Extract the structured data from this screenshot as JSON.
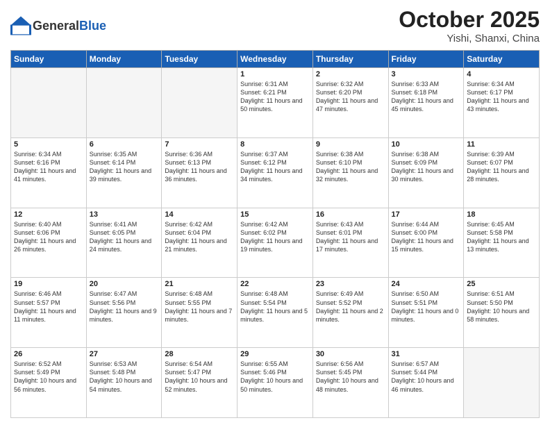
{
  "header": {
    "logo_general": "General",
    "logo_blue": "Blue",
    "month": "October 2025",
    "location": "Yishi, Shanxi, China"
  },
  "weekdays": [
    "Sunday",
    "Monday",
    "Tuesday",
    "Wednesday",
    "Thursday",
    "Friday",
    "Saturday"
  ],
  "weeks": [
    [
      {
        "day": "",
        "info": ""
      },
      {
        "day": "",
        "info": ""
      },
      {
        "day": "",
        "info": ""
      },
      {
        "day": "1",
        "info": "Sunrise: 6:31 AM\nSunset: 6:21 PM\nDaylight: 11 hours\nand 50 minutes."
      },
      {
        "day": "2",
        "info": "Sunrise: 6:32 AM\nSunset: 6:20 PM\nDaylight: 11 hours\nand 47 minutes."
      },
      {
        "day": "3",
        "info": "Sunrise: 6:33 AM\nSunset: 6:18 PM\nDaylight: 11 hours\nand 45 minutes."
      },
      {
        "day": "4",
        "info": "Sunrise: 6:34 AM\nSunset: 6:17 PM\nDaylight: 11 hours\nand 43 minutes."
      }
    ],
    [
      {
        "day": "5",
        "info": "Sunrise: 6:34 AM\nSunset: 6:16 PM\nDaylight: 11 hours\nand 41 minutes."
      },
      {
        "day": "6",
        "info": "Sunrise: 6:35 AM\nSunset: 6:14 PM\nDaylight: 11 hours\nand 39 minutes."
      },
      {
        "day": "7",
        "info": "Sunrise: 6:36 AM\nSunset: 6:13 PM\nDaylight: 11 hours\nand 36 minutes."
      },
      {
        "day": "8",
        "info": "Sunrise: 6:37 AM\nSunset: 6:12 PM\nDaylight: 11 hours\nand 34 minutes."
      },
      {
        "day": "9",
        "info": "Sunrise: 6:38 AM\nSunset: 6:10 PM\nDaylight: 11 hours\nand 32 minutes."
      },
      {
        "day": "10",
        "info": "Sunrise: 6:38 AM\nSunset: 6:09 PM\nDaylight: 11 hours\nand 30 minutes."
      },
      {
        "day": "11",
        "info": "Sunrise: 6:39 AM\nSunset: 6:07 PM\nDaylight: 11 hours\nand 28 minutes."
      }
    ],
    [
      {
        "day": "12",
        "info": "Sunrise: 6:40 AM\nSunset: 6:06 PM\nDaylight: 11 hours\nand 26 minutes."
      },
      {
        "day": "13",
        "info": "Sunrise: 6:41 AM\nSunset: 6:05 PM\nDaylight: 11 hours\nand 24 minutes."
      },
      {
        "day": "14",
        "info": "Sunrise: 6:42 AM\nSunset: 6:04 PM\nDaylight: 11 hours\nand 21 minutes."
      },
      {
        "day": "15",
        "info": "Sunrise: 6:42 AM\nSunset: 6:02 PM\nDaylight: 11 hours\nand 19 minutes."
      },
      {
        "day": "16",
        "info": "Sunrise: 6:43 AM\nSunset: 6:01 PM\nDaylight: 11 hours\nand 17 minutes."
      },
      {
        "day": "17",
        "info": "Sunrise: 6:44 AM\nSunset: 6:00 PM\nDaylight: 11 hours\nand 15 minutes."
      },
      {
        "day": "18",
        "info": "Sunrise: 6:45 AM\nSunset: 5:58 PM\nDaylight: 11 hours\nand 13 minutes."
      }
    ],
    [
      {
        "day": "19",
        "info": "Sunrise: 6:46 AM\nSunset: 5:57 PM\nDaylight: 11 hours\nand 11 minutes."
      },
      {
        "day": "20",
        "info": "Sunrise: 6:47 AM\nSunset: 5:56 PM\nDaylight: 11 hours\nand 9 minutes."
      },
      {
        "day": "21",
        "info": "Sunrise: 6:48 AM\nSunset: 5:55 PM\nDaylight: 11 hours\nand 7 minutes."
      },
      {
        "day": "22",
        "info": "Sunrise: 6:48 AM\nSunset: 5:54 PM\nDaylight: 11 hours\nand 5 minutes."
      },
      {
        "day": "23",
        "info": "Sunrise: 6:49 AM\nSunset: 5:52 PM\nDaylight: 11 hours\nand 2 minutes."
      },
      {
        "day": "24",
        "info": "Sunrise: 6:50 AM\nSunset: 5:51 PM\nDaylight: 11 hours\nand 0 minutes."
      },
      {
        "day": "25",
        "info": "Sunrise: 6:51 AM\nSunset: 5:50 PM\nDaylight: 10 hours\nand 58 minutes."
      }
    ],
    [
      {
        "day": "26",
        "info": "Sunrise: 6:52 AM\nSunset: 5:49 PM\nDaylight: 10 hours\nand 56 minutes."
      },
      {
        "day": "27",
        "info": "Sunrise: 6:53 AM\nSunset: 5:48 PM\nDaylight: 10 hours\nand 54 minutes."
      },
      {
        "day": "28",
        "info": "Sunrise: 6:54 AM\nSunset: 5:47 PM\nDaylight: 10 hours\nand 52 minutes."
      },
      {
        "day": "29",
        "info": "Sunrise: 6:55 AM\nSunset: 5:46 PM\nDaylight: 10 hours\nand 50 minutes."
      },
      {
        "day": "30",
        "info": "Sunrise: 6:56 AM\nSunset: 5:45 PM\nDaylight: 10 hours\nand 48 minutes."
      },
      {
        "day": "31",
        "info": "Sunrise: 6:57 AM\nSunset: 5:44 PM\nDaylight: 10 hours\nand 46 minutes."
      },
      {
        "day": "",
        "info": ""
      }
    ]
  ]
}
